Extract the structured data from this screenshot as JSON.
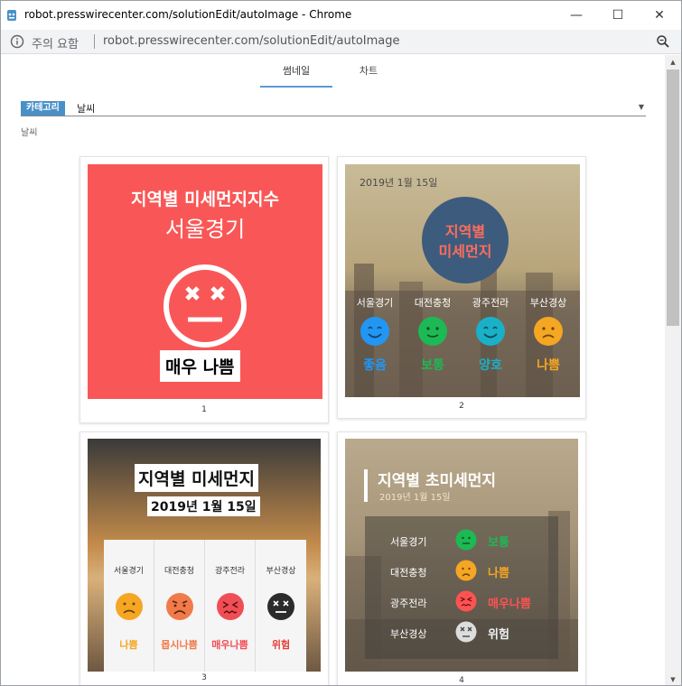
{
  "window": {
    "title": "robot.presswirecenter.com/solutionEdit/autoImage - Chrome",
    "controls": {
      "minimize": "—",
      "maximize": "☐",
      "close": "✕"
    }
  },
  "addressbar": {
    "security_text": "주의 요함",
    "url": "robot.presswirecenter.com/solutionEdit/autoImage"
  },
  "tabs": [
    {
      "label": "썸네일",
      "active": true
    },
    {
      "label": "차트",
      "active": false
    }
  ],
  "category": {
    "badge": "카테고리",
    "value": "날씨",
    "sub_label": "날씨"
  },
  "colors": {
    "good": "#2196f3",
    "normal": "#1db954",
    "bad": "#f5a623",
    "very_bad": "#ff5252",
    "danger": "#333333"
  },
  "cards": [
    {
      "number": "1",
      "title": "지역별 미세먼지지수",
      "region": "서울경기",
      "status": "매우 나쁨"
    },
    {
      "number": "2",
      "date": "2019년 1월 15일",
      "title_line1": "지역별",
      "title_line2": "미세먼지",
      "regions": [
        {
          "name": "서울경기",
          "status": "좋음",
          "color": "#2196f3",
          "face": "smile-face-icon"
        },
        {
          "name": "대전충청",
          "status": "보통",
          "color": "#1db954",
          "face": "neutral-face-icon"
        },
        {
          "name": "광주전라",
          "status": "양호",
          "color": "#1ab0c8",
          "face": "smile-face-icon"
        },
        {
          "name": "부산경상",
          "status": "나쁨",
          "color": "#f5a623",
          "face": "sad-face-icon"
        }
      ]
    },
    {
      "number": "3",
      "title": "지역별 미세먼지",
      "date": "2019년 1월 15일",
      "regions": [
        {
          "name": "서울경기",
          "status": "나쁨",
          "color": "#f5a623",
          "face": "sad-face-icon"
        },
        {
          "name": "대전충청",
          "status": "몹시나쁨",
          "color": "#f07a4a",
          "face": "angry-face-icon"
        },
        {
          "name": "광주전라",
          "status": "매우나쁨",
          "color": "#f04e55",
          "face": "dizzy-face-icon"
        },
        {
          "name": "부산경상",
          "status": "위험",
          "color": "#e53935",
          "face": "dead-face-icon"
        }
      ]
    },
    {
      "number": "4",
      "title": "지역별 초미세먼지",
      "date": "2019년 1월 15일",
      "regions": [
        {
          "name": "서울경기",
          "status": "보통",
          "color": "#1db954",
          "face": "neutral-face-icon"
        },
        {
          "name": "대전충청",
          "status": "나쁨",
          "color": "#f5a623",
          "face": "sad-face-icon"
        },
        {
          "name": "광주전라",
          "status": "매우나쁨",
          "color": "#ff5252",
          "face": "dizzy-face-icon"
        },
        {
          "name": "부산경상",
          "status": "위험",
          "color": "#dddddd",
          "face": "dead-face-icon"
        }
      ]
    }
  ]
}
